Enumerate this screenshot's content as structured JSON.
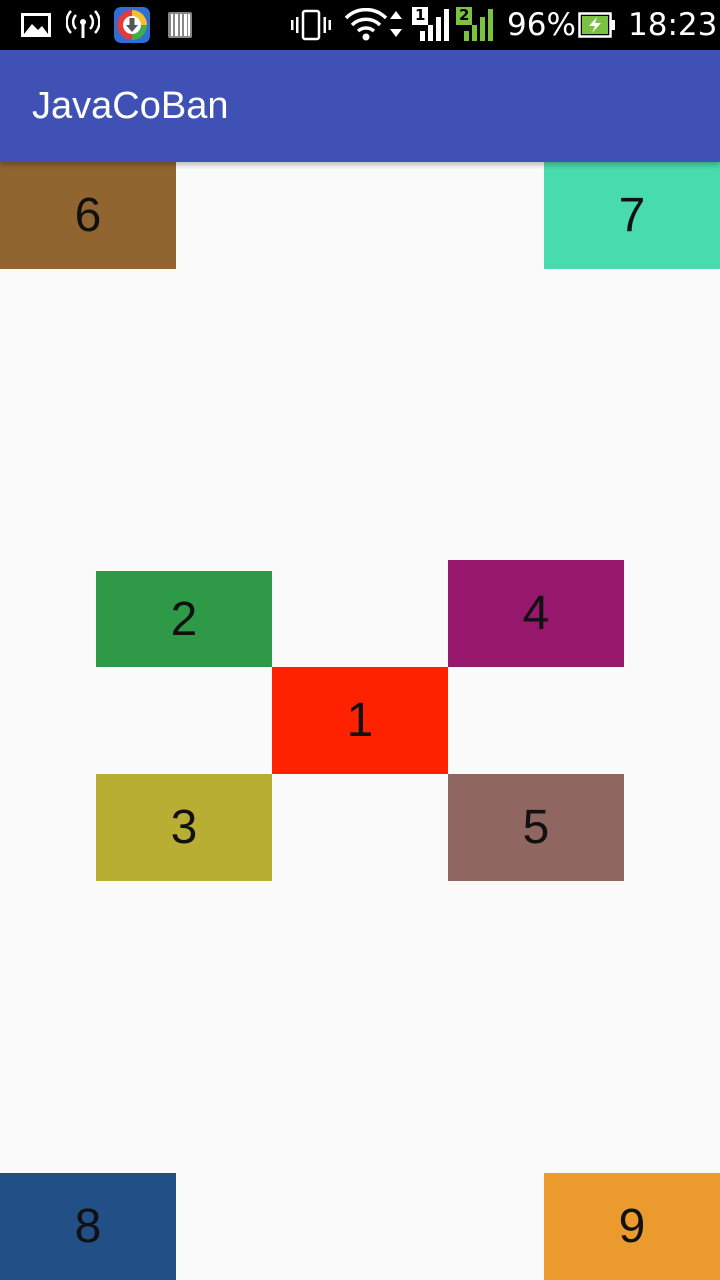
{
  "status_bar": {
    "battery_percent": "96%",
    "time": "18:23",
    "sim1_label": "1",
    "sim2_label": "2",
    "icons": [
      "gallery-icon",
      "hotspot-icon",
      "download-app-icon",
      "barcode-icon",
      "vibrate-icon",
      "wifi-icon",
      "signal-sim1-icon",
      "signal-sim2-icon",
      "battery-charging-icon"
    ]
  },
  "app_bar": {
    "title": "JavaCoBan",
    "color": "#3f51b5"
  },
  "boxes": [
    {
      "label": "1",
      "color": "#ff2200"
    },
    {
      "label": "2",
      "color": "#2e9946"
    },
    {
      "label": "3",
      "color": "#b8ae33"
    },
    {
      "label": "4",
      "color": "#96176b"
    },
    {
      "label": "5",
      "color": "#8f6660"
    },
    {
      "label": "6",
      "color": "#906530"
    },
    {
      "label": "7",
      "color": "#48dbad"
    },
    {
      "label": "8",
      "color": "#224f86"
    },
    {
      "label": "9",
      "color": "#eb9a2e"
    }
  ]
}
